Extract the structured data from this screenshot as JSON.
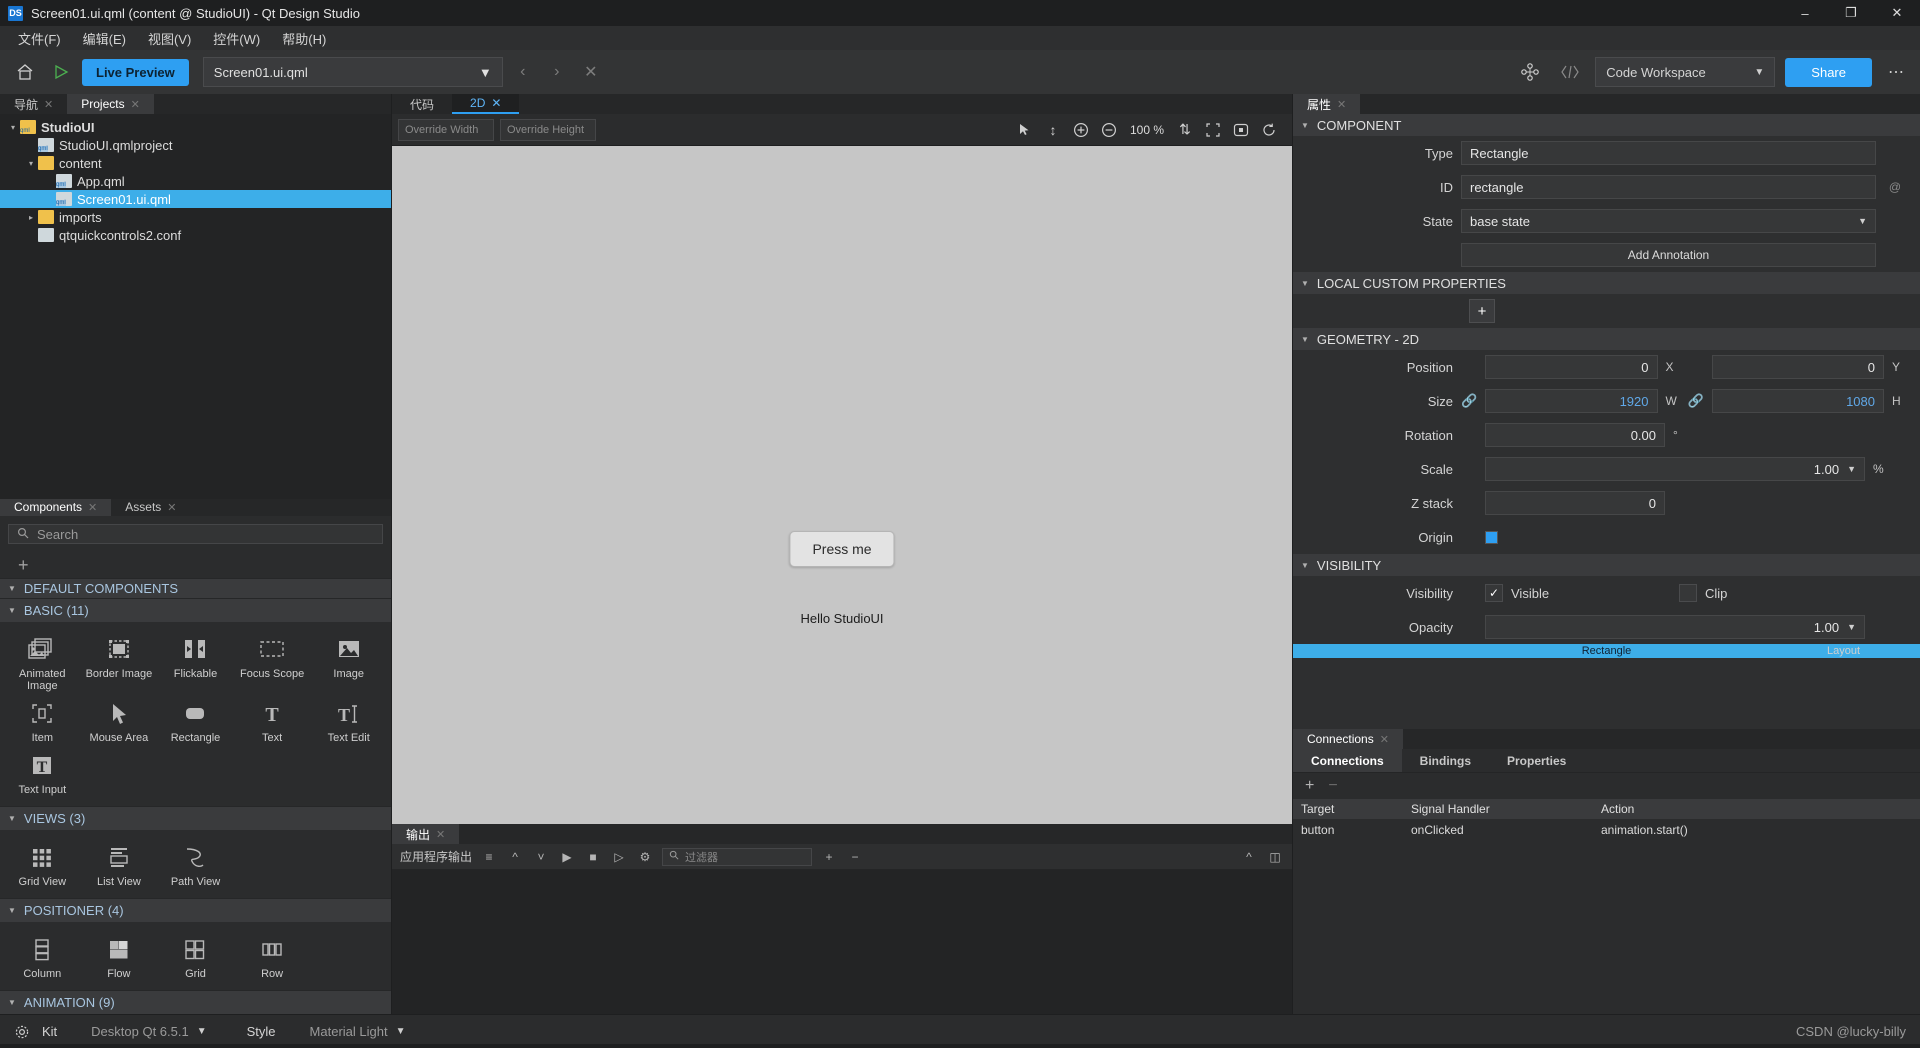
{
  "window": {
    "title": "Screen01.ui.qml (content @ StudioUI) - Qt Design Studio",
    "logo": "DS",
    "minimize": "–",
    "maximize": "❐",
    "close": "✕"
  },
  "menubar": {
    "items": [
      {
        "label": "文件(F)",
        "name": "menu-file"
      },
      {
        "label": "编辑(E)",
        "name": "menu-edit"
      },
      {
        "label": "视图(V)",
        "name": "menu-view"
      },
      {
        "label": "控件(W)",
        "name": "menu-widgets"
      },
      {
        "label": "帮助(H)",
        "name": "menu-help"
      }
    ]
  },
  "toolbar": {
    "home_icon": "⌂",
    "run_icon": "▷",
    "live_preview": "Live Preview",
    "file_name": "Screen01.ui.qml",
    "back_icon": "‹",
    "forward_icon": "›",
    "close_icon": "✕",
    "nodes_icon": "∷",
    "code_icon": "⟨/⟩",
    "workspace": "Code Workspace",
    "share": "Share",
    "more": "⋯"
  },
  "left": {
    "tabs": [
      {
        "label": "导航",
        "name": "tab-navigator",
        "active": false
      },
      {
        "label": "Projects",
        "name": "tab-projects",
        "active": true
      }
    ],
    "tree": [
      {
        "label": "StudioUI",
        "indent": 0,
        "twist": "▾",
        "icon": "qmlfolder",
        "bold": true,
        "selected": false
      },
      {
        "label": "StudioUI.qmlproject",
        "indent": 1,
        "twist": "",
        "icon": "file",
        "bold": false,
        "selected": false
      },
      {
        "label": "content",
        "indent": 1,
        "twist": "▾",
        "icon": "folder",
        "bold": false,
        "selected": false
      },
      {
        "label": "App.qml",
        "indent": 2,
        "twist": "",
        "icon": "file",
        "bold": false,
        "selected": false
      },
      {
        "label": "Screen01.ui.qml",
        "indent": 2,
        "twist": "",
        "icon": "file",
        "bold": false,
        "selected": true
      },
      {
        "label": "imports",
        "indent": 1,
        "twist": "▸",
        "icon": "folder",
        "bold": false,
        "selected": false
      },
      {
        "label": "qtquickcontrols2.conf",
        "indent": 1,
        "twist": "",
        "icon": "conf",
        "bold": false,
        "selected": false
      }
    ]
  },
  "components": {
    "tabs": [
      {
        "label": "Components",
        "name": "tab-components",
        "active": true
      },
      {
        "label": "Assets",
        "name": "tab-assets",
        "active": false
      }
    ],
    "search_placeholder": "Search",
    "search_icon": "⚲",
    "add_icon": "+",
    "default_header": "DEFAULT COMPONENTS",
    "sections": [
      {
        "title": "BASIC (11)",
        "items": [
          {
            "label": "Animated Image",
            "icon": "animated-image-icon"
          },
          {
            "label": "Border Image",
            "icon": "border-image-icon"
          },
          {
            "label": "Flickable",
            "icon": "flickable-icon"
          },
          {
            "label": "Focus Scope",
            "icon": "focus-scope-icon"
          },
          {
            "label": "Image",
            "icon": "image-icon"
          },
          {
            "label": "Mouse Area",
            "icon": "mouse-area-icon"
          },
          {
            "label": "Rectangle",
            "icon": "rectangle-icon"
          },
          {
            "label": "Text",
            "icon": "text-icon"
          },
          {
            "label": "Text Edit",
            "icon": "text-edit-icon"
          },
          {
            "label": "Text Input",
            "icon": "text-input-icon"
          }
        ]
      },
      {
        "title": "VIEWS (3)",
        "items": [
          {
            "label": "Grid View",
            "icon": "grid-view-icon"
          },
          {
            "label": "List View",
            "icon": "list-view-icon"
          },
          {
            "label": "Path View",
            "icon": "path-view-icon"
          }
        ]
      },
      {
        "title": "POSITIONER (4)",
        "items": [
          {
            "label": "Column",
            "icon": "column-icon"
          },
          {
            "label": "Flow",
            "icon": "flow-icon"
          },
          {
            "label": "Grid",
            "icon": "grid-icon"
          },
          {
            "label": "Row",
            "icon": "row-icon"
          }
        ]
      },
      {
        "title": "ANIMATION (9)",
        "items": []
      }
    ],
    "item_label": "Item"
  },
  "center": {
    "tabs": [
      {
        "label": "代码",
        "name": "tab-code",
        "active": false
      },
      {
        "label": "2D",
        "name": "tab-2d",
        "active": true
      }
    ],
    "override_width_placeholder": "Override Width",
    "override_height_placeholder": "Override Height",
    "zoom": "100 %",
    "zoom_in_icon": "⊕",
    "zoom_out_icon": "⊖",
    "canvas": {
      "button_label": "Press me",
      "text_label": "Hello StudioUI"
    },
    "output": {
      "tab_label": "输出",
      "title": "应用程序输出",
      "filter_placeholder": "过滤器",
      "search_icon": "⚲",
      "play_icon": "▶",
      "stop_icon": "■",
      "gear_icon": "⚙",
      "plus_icon": "+",
      "minus_icon": "−"
    }
  },
  "properties": {
    "tab_label": "属性",
    "sections": {
      "component": {
        "title": "COMPONENT",
        "type_label": "Type",
        "type_value": "Rectangle",
        "id_label": "ID",
        "id_value": "rectangle",
        "state_label": "State",
        "state_value": "base state",
        "add_annotation": "Add Annotation",
        "at_icon": "@"
      },
      "local_custom": {
        "title": "LOCAL CUSTOM PROPERTIES",
        "add_icon": "+"
      },
      "geometry": {
        "title": "GEOMETRY - 2D",
        "position_label": "Position",
        "position_x": "0",
        "position_x_suffix": "X",
        "position_y": "0",
        "position_y_suffix": "Y",
        "size_label": "Size",
        "size_w": "1920",
        "size_w_suffix": "W",
        "size_h": "1080",
        "size_h_suffix": "H",
        "rotation_label": "Rotation",
        "rotation_value": "0.00",
        "rotation_suffix": "°",
        "scale_label": "Scale",
        "scale_value": "1.00",
        "scale_suffix": "%",
        "zstack_label": "Z stack",
        "zstack_value": "0",
        "origin_label": "Origin"
      },
      "visibility": {
        "title": "VISIBILITY",
        "visibility_label": "Visibility",
        "visible_label": "Visible",
        "visible_checked": "✓",
        "clip_label": "Clip",
        "opacity_label": "Opacity",
        "opacity_value": "1.00"
      }
    },
    "selection_strip": "Rectangle",
    "layout_label": "Layout"
  },
  "connections": {
    "tab_label": "Connections",
    "subtabs": [
      {
        "label": "Connections",
        "name": "subtab-connections",
        "active": true
      },
      {
        "label": "Bindings",
        "name": "subtab-bindings",
        "active": false
      },
      {
        "label": "Properties",
        "name": "subtab-properties",
        "active": false
      }
    ],
    "add_icon": "+",
    "remove_icon": "−",
    "columns": [
      "Target",
      "Signal Handler",
      "Action"
    ],
    "rows": [
      {
        "target": "button",
        "signal": "onClicked",
        "action": "animation.start()"
      }
    ]
  },
  "statusbar": {
    "gear_icon": "⚙",
    "kit_label": "Kit",
    "kit_value": "Desktop Qt 6.5.1",
    "style_label": "Style",
    "style_value": "Material Light",
    "watermark": "CSDN @lucky-billy"
  },
  "colors": {
    "accent": "#2e9ff2",
    "selection": "#3daee9",
    "panel_bg": "#2e2f30",
    "canvas_bg": "#c6c6c6"
  }
}
